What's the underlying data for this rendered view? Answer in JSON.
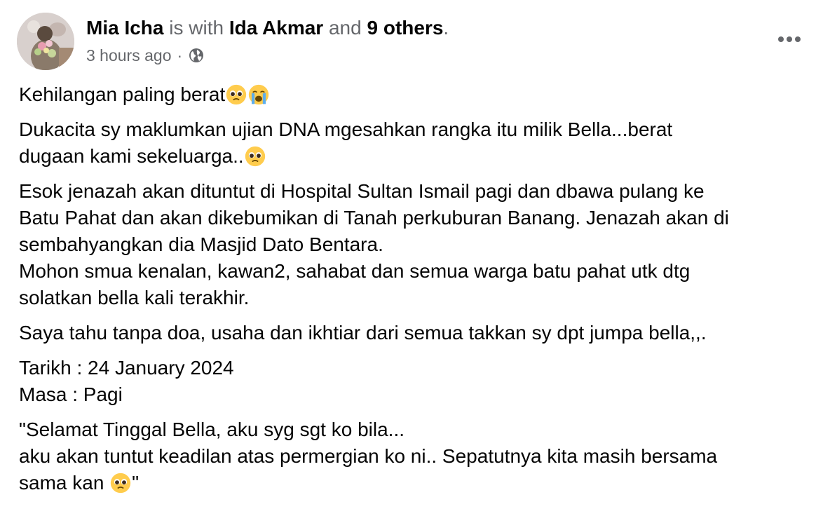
{
  "post": {
    "author": "Mia Icha",
    "with_text": " is with ",
    "tagged": "Ida Akmar",
    "and_text": " and ",
    "others": "9 others",
    "period": ".",
    "time": "3 hours ago",
    "separator": "·",
    "privacy_icon": "globe-icon",
    "more_icon": "more-options-icon",
    "paragraphs": {
      "p1": "Kehilangan paling berat",
      "p2_l1": "Dukacita sy maklumkan ujian DNA mgesahkan rangka itu milik Bella...berat",
      "p2_l2": "dugaan kami sekeluarga..",
      "p3_l1": "Esok jenazah akan dituntut di Hospital Sultan Ismail pagi dan dbawa pulang ke",
      "p3_l2": "Batu Pahat dan akan dikebumikan di Tanah perkuburan Banang. Jenazah akan di",
      "p3_l3": "sembahyangkan dia Masjid Dato Bentara.",
      "p3_l4": "Mohon smua kenalan, kawan2, sahabat dan semua warga batu pahat utk dtg",
      "p3_l5": "solatkan bella kali terakhir.",
      "p4": "Saya tahu tanpa doa, usaha dan ikhtiar dari semua takkan sy dpt jumpa bella,,.",
      "p5_l1": "Tarikh : 24 January 2024",
      "p5_l2": "Masa : Pagi",
      "p6_l1": "\"Selamat Tinggal Bella, aku syg sgt ko bila...",
      "p6_l2": "aku akan tuntut keadilan atas permergian ko ni.. Sepatutnya kita masih bersama",
      "p6_l3": "sama kan ",
      "p6_end": "\""
    },
    "emojis": [
      "pleading-face-emoji",
      "loudly-crying-face-emoji"
    ]
  },
  "colors": {
    "text": "#050505",
    "secondary_text": "#65676b",
    "emoji_yellow": "#ffcc4d"
  }
}
